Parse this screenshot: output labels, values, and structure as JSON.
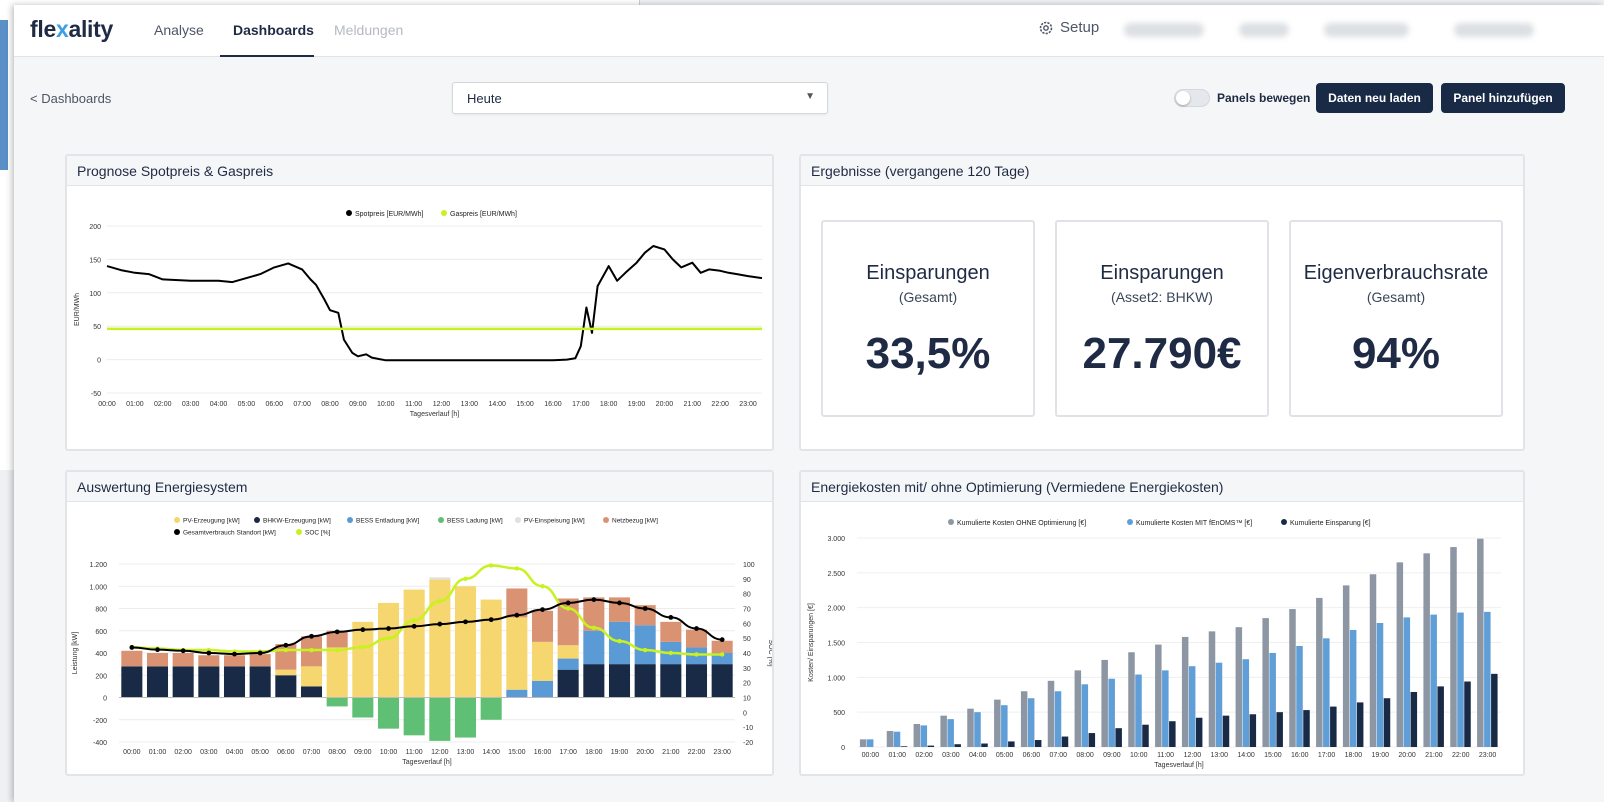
{
  "app": {
    "logo": {
      "part1": "fle",
      "x": "x",
      "part2": "ality"
    },
    "nav": [
      "Analyse",
      "Dashboards",
      "Meldungen"
    ],
    "setup": "Setup"
  },
  "toolbar": {
    "back": "< Dashboards",
    "period": "Heute",
    "toggle_label": "Panels bewegen",
    "reload": "Daten neu laden",
    "add_panel": "Panel hinzufügen"
  },
  "panels": {
    "spot": {
      "title": "Prognose Spotpreis & Gaspreis"
    },
    "results": {
      "title": "Ergebnisse (vergangene 120 Tage)",
      "kpis": [
        {
          "title": "Einsparungen",
          "subtitle": "(Gesamt)",
          "value": "33,5%"
        },
        {
          "title": "Einsparungen",
          "subtitle": "(Asset2: BHKW)",
          "value": "27.790€"
        },
        {
          "title": "Eigenverbrauchsrate",
          "subtitle": "(Gesamt)",
          "value": "94%"
        }
      ]
    },
    "energy": {
      "title": "Auswertung Energiesystem"
    },
    "costs": {
      "title": "Energiekosten mit/ ohne Optimierung (Vermiedene Energiekosten)"
    }
  },
  "colors": {
    "navy": "#182a45",
    "pv": "#f6d66e",
    "bess_in": "#5b9bd5",
    "bess_load": "#5fbf74",
    "net": "#d99373",
    "feed": "#e0e0e0",
    "gas": "#c8f21f",
    "gray": "#8d96a3",
    "blue": "#5f9ed6"
  },
  "chart_data": [
    {
      "type": "line",
      "x": [
        "00:00",
        "01:00",
        "02:00",
        "03:00",
        "04:00",
        "05:00",
        "06:00",
        "07:00",
        "08:00",
        "09:00",
        "10:00",
        "11:00",
        "12:00",
        "13:00",
        "14:00",
        "15:00",
        "16:00",
        "17:00",
        "18:00",
        "19:00",
        "20:00",
        "21:00",
        "22:00",
        "23:00"
      ],
      "xlabel": "Tagesverlauf [h]",
      "ylabel": "EUR/MWh",
      "ylim": [
        -50,
        200
      ],
      "yticks": [
        -50,
        0,
        50,
        100,
        150,
        200
      ],
      "series": [
        {
          "name": "Spotpreis [EUR/MWh]",
          "color": "#000000",
          "t": [
            0,
            0.5,
            1,
            1.5,
            2,
            3,
            4,
            4.5,
            5,
            5.5,
            6,
            6.5,
            7,
            7.3,
            7.5,
            7.8,
            8,
            8.3,
            8.5,
            8.8,
            9,
            9.3,
            9.5,
            10,
            11,
            12,
            13,
            14,
            15,
            15.5,
            16,
            16.5,
            16.8,
            17,
            17.2,
            17.4,
            17.6,
            18,
            18.3,
            18.6,
            19,
            19.3,
            19.6,
            20,
            20.3,
            20.6,
            21,
            21.3,
            21.6,
            22,
            22.3,
            22.6,
            23,
            23.5
          ],
          "values": [
            140,
            134,
            130,
            128,
            120,
            118,
            118,
            116,
            122,
            128,
            138,
            144,
            135,
            120,
            112,
            90,
            74,
            70,
            30,
            10,
            5,
            8,
            3,
            -1,
            -1,
            -1,
            -1,
            -1,
            -1,
            -1,
            -1,
            0,
            2,
            20,
            78,
            40,
            110,
            140,
            118,
            130,
            145,
            160,
            170,
            165,
            150,
            138,
            145,
            130,
            135,
            133,
            130,
            128,
            125,
            122
          ]
        },
        {
          "name": "Gaspreis [EUR/MWh]",
          "color": "#c8f21f",
          "t": [
            0,
            23.5
          ],
          "values": [
            46,
            46
          ]
        }
      ]
    },
    {
      "type": "bar",
      "x": [
        "00:00",
        "01:00",
        "02:00",
        "03:00",
        "04:00",
        "05:00",
        "06:00",
        "07:00",
        "08:00",
        "09:00",
        "10:00",
        "11:00",
        "12:00",
        "13:00",
        "14:00",
        "15:00",
        "16:00",
        "17:00",
        "18:00",
        "19:00",
        "20:00",
        "21:00",
        "22:00",
        "23:00"
      ],
      "xlabel": "Tagesverlauf [h]",
      "ylabel": "Leistung [kW]",
      "y2label": "SOC [%]",
      "ylim": [
        -400,
        1200
      ],
      "yticks": [
        -400,
        -200,
        0,
        200,
        400,
        600,
        800,
        1000,
        1200
      ],
      "y2lim": [
        -20,
        100
      ],
      "y2ticks": [
        -20,
        -10,
        0,
        10,
        20,
        30,
        40,
        50,
        60,
        70,
        80,
        90,
        100
      ],
      "series": [
        {
          "name": "PV-Erzeugung [kW]",
          "color": "#f6d66e",
          "values": [
            0,
            0,
            0,
            0,
            0,
            0,
            50,
            180,
            450,
            680,
            850,
            970,
            1060,
            1000,
            880,
            650,
            350,
            120,
            0,
            0,
            0,
            0,
            0,
            0
          ]
        },
        {
          "name": "BHKW-Erzeugung [kW]",
          "color": "#182a45",
          "values": [
            280,
            280,
            280,
            280,
            280,
            280,
            200,
            100,
            0,
            0,
            0,
            0,
            0,
            0,
            0,
            0,
            0,
            250,
            300,
            300,
            300,
            300,
            300,
            300
          ]
        },
        {
          "name": "BESS Entladung [kW]",
          "color": "#5b9bd5",
          "values": [
            0,
            0,
            0,
            0,
            0,
            0,
            0,
            0,
            0,
            0,
            0,
            0,
            0,
            0,
            0,
            70,
            150,
            100,
            300,
            380,
            350,
            200,
            150,
            100
          ]
        },
        {
          "name": "BESS Ladung [kW]",
          "color": "#5fbf74",
          "values": [
            0,
            0,
            0,
            0,
            0,
            0,
            0,
            0,
            -80,
            -180,
            -280,
            -340,
            -390,
            -360,
            -200,
            0,
            0,
            0,
            0,
            0,
            0,
            0,
            0,
            0
          ]
        },
        {
          "name": "PV-Einspeisung [kW]",
          "color": "#e0e0e0",
          "values": [
            0,
            0,
            0,
            0,
            0,
            0,
            0,
            0,
            0,
            0,
            0,
            0,
            20,
            0,
            0,
            0,
            0,
            0,
            0,
            0,
            0,
            0,
            0,
            0
          ]
        },
        {
          "name": "Netzbezug [kW]",
          "color": "#d99373",
          "values": [
            140,
            120,
            120,
            100,
            100,
            110,
            230,
            270,
            150,
            0,
            0,
            0,
            0,
            0,
            0,
            260,
            280,
            420,
            300,
            220,
            180,
            180,
            160,
            110
          ]
        },
        {
          "name": "Gesamtverbrauch Standort [kW]",
          "color": "#000000",
          "values": [
            450,
            430,
            420,
            400,
            390,
            400,
            470,
            550,
            590,
            610,
            620,
            640,
            660,
            680,
            700,
            740,
            790,
            850,
            880,
            850,
            800,
            720,
            620,
            520
          ]
        },
        {
          "name": "SOC [%]",
          "color": "#c8f21f",
          "axis": "right",
          "values": [
            44,
            43,
            42,
            42,
            41,
            41,
            42,
            42,
            42,
            44,
            50,
            62,
            75,
            90,
            99,
            97,
            85,
            70,
            57,
            48,
            42,
            40,
            39,
            39
          ]
        }
      ]
    },
    {
      "type": "bar",
      "x": [
        "00:00",
        "01:00",
        "02:00",
        "03:00",
        "04:00",
        "05:00",
        "06:00",
        "07:00",
        "08:00",
        "09:00",
        "10:00",
        "11:00",
        "12:00",
        "13:00",
        "14:00",
        "15:00",
        "16:00",
        "17:00",
        "18:00",
        "19:00",
        "20:00",
        "21:00",
        "22:00",
        "23:00"
      ],
      "xlabel": "Tagesverlauf [h]",
      "ylabel": "Kosten/ Einsparungen [€]",
      "ylim": [
        0,
        3000
      ],
      "yticks": [
        0,
        500,
        1000,
        1500,
        2000,
        2500,
        3000
      ],
      "series": [
        {
          "name": "Kumulierte Kosten OHNE Optimierung [€]",
          "color": "#8d96a3",
          "values": [
            110,
            230,
            330,
            450,
            550,
            680,
            800,
            950,
            1100,
            1250,
            1360,
            1470,
            1580,
            1660,
            1720,
            1850,
            1980,
            2140,
            2320,
            2480,
            2650,
            2780,
            2870,
            2990
          ]
        },
        {
          "name": "Kumulierte Kosten MIT fEnOMS™ [€]",
          "color": "#5f9ed6",
          "values": [
            110,
            220,
            310,
            400,
            500,
            600,
            700,
            800,
            900,
            980,
            1040,
            1100,
            1160,
            1210,
            1260,
            1350,
            1450,
            1560,
            1680,
            1780,
            1860,
            1900,
            1930,
            1940
          ]
        },
        {
          "name": "Kumulierte Einsparung [€]",
          "color": "#182a45",
          "values": [
            0,
            10,
            20,
            40,
            50,
            80,
            100,
            150,
            200,
            270,
            320,
            370,
            420,
            450,
            470,
            500,
            530,
            580,
            640,
            700,
            790,
            870,
            940,
            1050
          ]
        }
      ]
    }
  ]
}
